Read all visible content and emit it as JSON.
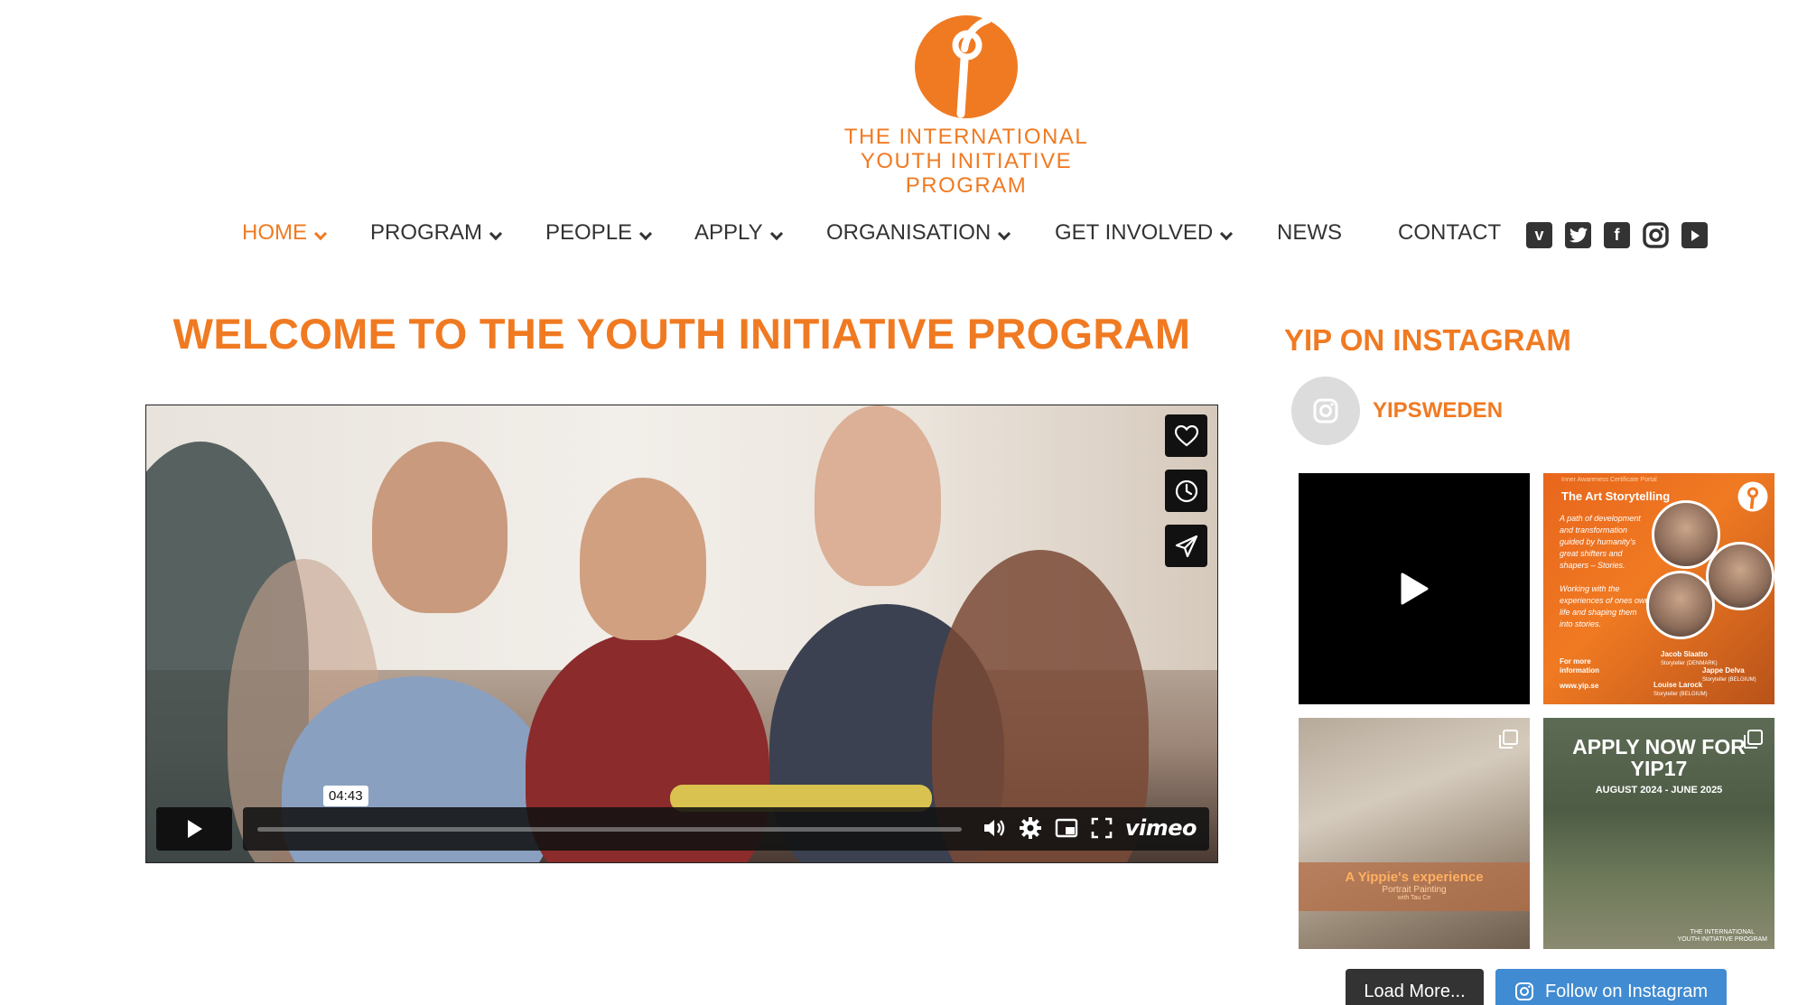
{
  "brand": {
    "line1": "THE INTERNATIONAL",
    "line2": "YOUTH INITIATIVE PROGRAM",
    "color": "#f07a22"
  },
  "nav": {
    "items": [
      {
        "label": "HOME",
        "dropdown": true,
        "active": true
      },
      {
        "label": "PROGRAM",
        "dropdown": true
      },
      {
        "label": "PEOPLE",
        "dropdown": true
      },
      {
        "label": "APPLY",
        "dropdown": true
      },
      {
        "label": "ORGANISATION",
        "dropdown": true
      },
      {
        "label": "GET INVOLVED",
        "dropdown": true
      },
      {
        "label": "NEWS",
        "dropdown": false
      },
      {
        "label": "CONTACT",
        "dropdown": false
      }
    ],
    "social_icons": [
      "vimeo-icon",
      "twitter-icon",
      "facebook-icon",
      "instagram-icon",
      "youtube-icon"
    ]
  },
  "main": {
    "title": "WELCOME TO THE YOUTH INITIATIVE PROGRAM",
    "video": {
      "time": "04:43",
      "provider": "vimeo",
      "side_buttons": [
        "heart-icon",
        "clock-icon",
        "send-icon"
      ]
    }
  },
  "sidebar": {
    "title": "YIP ON INSTAGRAM",
    "handle": "YIPSWEDEN",
    "tiles": {
      "tile2": {
        "kicker": "Inner Awareness Certificate Portal",
        "title": "The Art Storytelling",
        "body": "A path of development and transformation guided by humanity's great shifters and shapers – Stories.",
        "body2": "Working with the experiences of ones own life and shaping them into stories.",
        "more": "For more information",
        "url": "www.yip.se",
        "person1": "Jacob Slaatto",
        "person1_role": "Storyteller (DENMARK)",
        "person2": "Jappe Delva",
        "person2_role": "Storyteller (BELGIUM)",
        "person3": "Louise Larock",
        "person3_role": "Storyteller (BELGIUM)"
      },
      "tile3": {
        "title": "A Yippie's experience",
        "sub": "Portrait Painting",
        "sub2": "with Tau Ce"
      },
      "tile4": {
        "title": "APPLY NOW FOR YIP17",
        "dates": "AUGUST 2024 - JUNE 2025",
        "brand1": "THE INTERNATIONAL",
        "brand2": "YOUTH INITIATIVE PROGRAM"
      }
    },
    "load_more": "Load More...",
    "follow": "Follow on Instagram"
  }
}
